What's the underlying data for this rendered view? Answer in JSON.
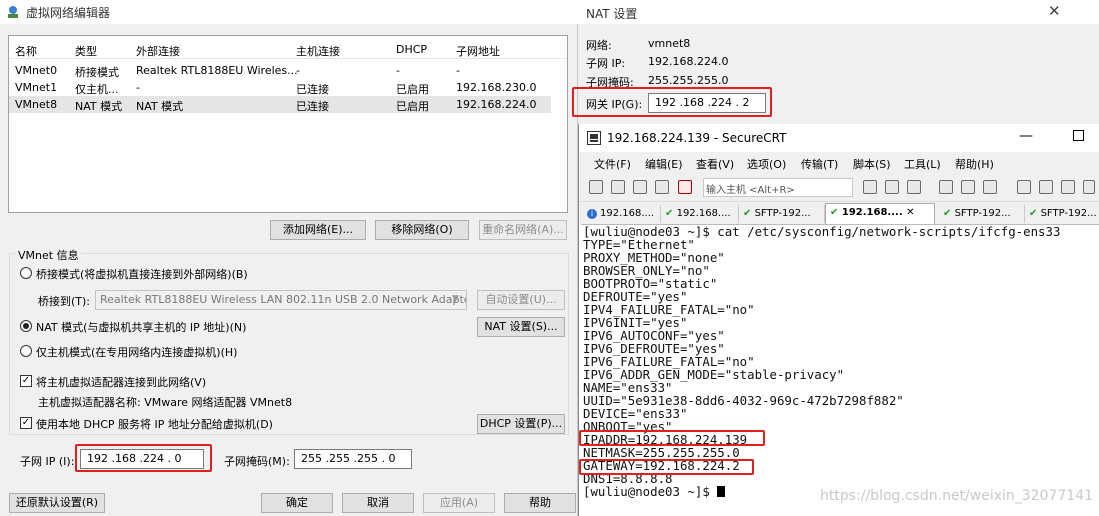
{
  "vne": {
    "title": "虚拟网络编辑器",
    "columns": [
      "名称",
      "类型",
      "外部连接",
      "主机连接",
      "DHCP",
      "子网地址"
    ],
    "rows": [
      [
        "VMnet0",
        "桥接模式",
        "Realtek RTL8188EU Wireles...",
        "-",
        "-",
        "-"
      ],
      [
        "VMnet1",
        "仅主机...",
        "-",
        "已连接",
        "已启用",
        "192.168.230.0"
      ],
      [
        "VMnet8",
        "NAT 模式",
        "NAT 模式",
        "已连接",
        "已启用",
        "192.168.224.0"
      ]
    ],
    "btn_add": "添加网络(E)...",
    "btn_remove": "移除网络(O)",
    "btn_rename": "重命名网络(A)...",
    "group_title": "VMnet 信息",
    "radio_bridge": "桥接模式(将虚拟机直接连接到外部网络)(B)",
    "bridge_to_label": "桥接到(T):",
    "bridge_adapter": "Realtek RTL8188EU Wireless LAN 802.11n USB 2.0 Network Adapter",
    "btn_auto": "自动设置(U)...",
    "radio_nat": "NAT 模式(与虚拟机共享主机的 IP 地址)(N)",
    "btn_nat": "NAT 设置(S)...",
    "radio_host": "仅主机模式(在专用网络内连接虚拟机)(H)",
    "check_connect": "将主机虚拟适配器连接到此网络(V)",
    "adapter_name": "主机虚拟适配器名称: VMware 网络适配器 VMnet8",
    "check_dhcp": "使用本地 DHCP 服务将 IP 地址分配给虚拟机(D)",
    "btn_dhcp": "DHCP 设置(P)...",
    "subnet_ip_label": "子网 IP (I):",
    "subnet_ip": "192 .168 .224 . 0",
    "subnet_mask_label": "子网掩码(M):",
    "subnet_mask": "255 .255 .255 . 0",
    "btn_restore": "还原默认设置(R)",
    "btn_ok": "确定",
    "btn_cancel": "取消",
    "btn_apply": "应用(A)",
    "btn_help": "帮助"
  },
  "nat": {
    "title": "NAT 设置",
    "network_label": "网络:",
    "network": "vmnet8",
    "subnet_ip_label": "子网 IP:",
    "subnet_ip": "192.168.224.0",
    "subnet_mask_label": "子网掩码:",
    "subnet_mask": "255.255.255.0",
    "gateway_label": "网关 IP(G):",
    "gateway": "192 .168 .224 . 2"
  },
  "crt": {
    "title": "192.168.224.139 - SecureCRT",
    "menus": [
      "文件(F)",
      "编辑(E)",
      "查看(V)",
      "选项(O)",
      "传输(T)",
      "脚本(S)",
      "工具(L)",
      "帮助(H)"
    ],
    "host_placeholder": "输入主机 <Alt+R>",
    "tabs": [
      "192.168....",
      "192.168....",
      "SFTP-192...",
      "192.168....",
      "SFTP-192...",
      "SFTP-192..."
    ],
    "terminal": [
      "[wuliu@node03 ~]$ cat /etc/sysconfig/network-scripts/ifcfg-ens33",
      "TYPE=\"Ethernet\"",
      "PROXY_METHOD=\"none\"",
      "BROWSER_ONLY=\"no\"",
      "BOOTPROTO=\"static\"",
      "DEFROUTE=\"yes\"",
      "IPV4_FAILURE_FATAL=\"no\"",
      "IPV6INIT=\"yes\"",
      "IPV6_AUTOCONF=\"yes\"",
      "IPV6_DEFROUTE=\"yes\"",
      "IPV6_FAILURE_FATAL=\"no\"",
      "IPV6_ADDR_GEN_MODE=\"stable-privacy\"",
      "NAME=\"ens33\"",
      "UUID=\"5e931e38-8dd6-4032-969c-472b7298f882\"",
      "DEVICE=\"ens33\"",
      "ONBOOT=\"yes\"",
      "IPADDR=192.168.224.139",
      "NETMASK=255.255.255.0",
      "GATEWAY=192.168.224.2",
      "DNS1=8.8.8.8",
      "[wuliu@node03 ~]$ "
    ]
  },
  "watermark": "https://blog.csdn.net/weixin_32077141"
}
